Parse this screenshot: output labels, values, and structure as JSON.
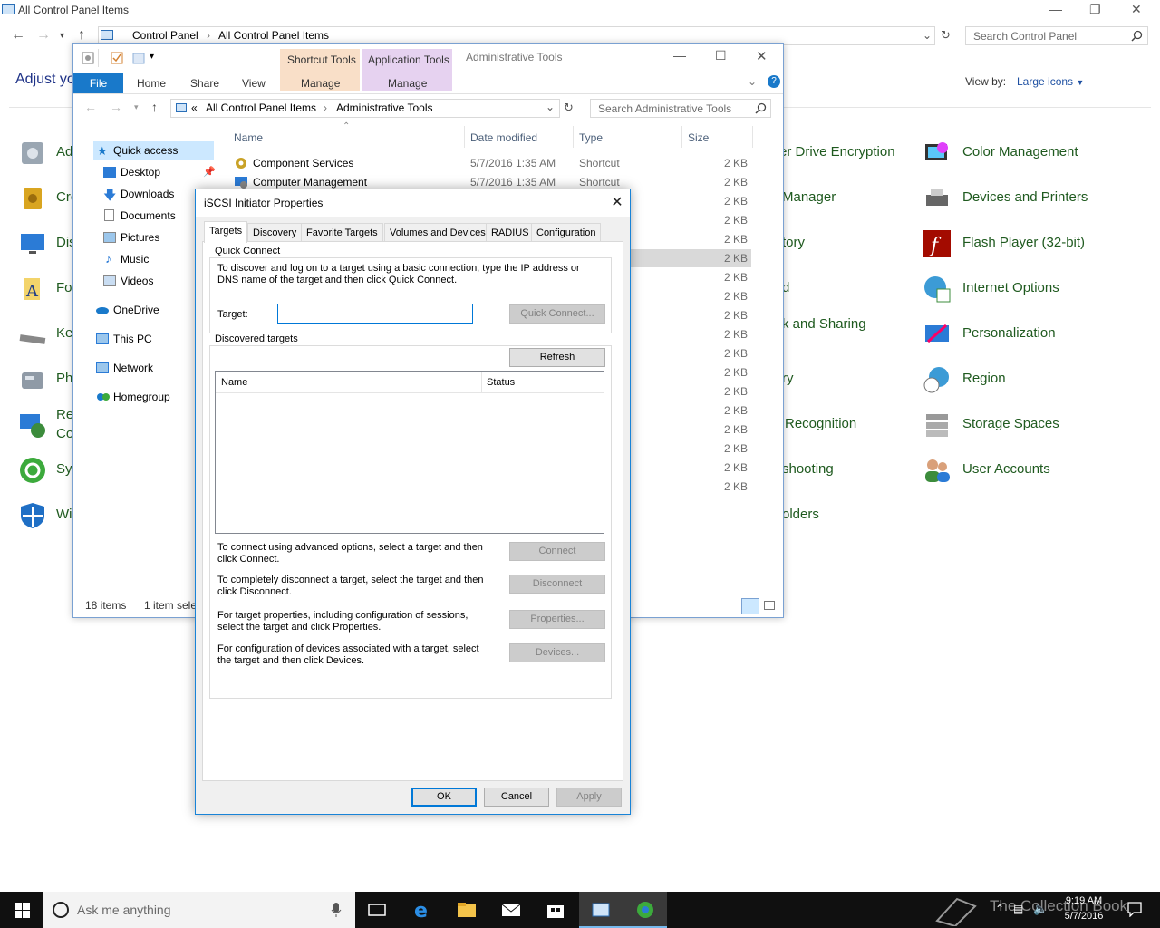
{
  "control_panel": {
    "title": "All Control Panel Items",
    "breadcrumb": [
      "Control Panel",
      "All Control Panel Items"
    ],
    "search_placeholder": "Search Control Panel",
    "heading": "Adjust yo",
    "view_by_label": "View by:",
    "view_by_value": "Large icons",
    "left_items": [
      {
        "label": "Ad",
        "icon": "admin-tools-icon"
      },
      {
        "label": "Cre",
        "icon": "credential-manager-icon"
      },
      {
        "label": "Dis",
        "icon": "display-icon"
      },
      {
        "label": "Fo",
        "icon": "fonts-icon"
      },
      {
        "label": "Ke",
        "icon": "keyboard-icon"
      },
      {
        "label": "Ph",
        "icon": "phone-modem-icon"
      },
      {
        "label": "Re",
        "label2": "Co",
        "icon": "remoteapp-icon"
      },
      {
        "label": "Sy",
        "icon": "sync-center-icon"
      },
      {
        "label": "Wi",
        "icon": "windows-defender-icon"
      }
    ],
    "mid_items": [
      "er Drive Encryption",
      "Manager",
      "tory",
      "d",
      "k and Sharing",
      "ry",
      "Recognition",
      "shooting",
      "olders"
    ],
    "right_items": [
      {
        "label": "Color Management",
        "icon": "color-management-icon",
        "color": "#8a2be2"
      },
      {
        "label": "Devices and Printers",
        "icon": "devices-printers-icon",
        "color": "#555555"
      },
      {
        "label": "Flash Player (32-bit)",
        "icon": "flash-player-icon",
        "color": "#b30b00"
      },
      {
        "label": "Internet Options",
        "icon": "internet-options-icon",
        "color": "#2b7bd6"
      },
      {
        "label": "Personalization",
        "icon": "personalization-icon",
        "color": "#2b7bd6"
      },
      {
        "label": "Region",
        "icon": "region-icon",
        "color": "#2b7bd6"
      },
      {
        "label": "Storage Spaces",
        "icon": "storage-spaces-icon",
        "color": "#777777"
      },
      {
        "label": "User Accounts",
        "icon": "user-accounts-icon",
        "color": "#3c8c3c"
      },
      {
        "label": "",
        "icon": "",
        "color": ""
      }
    ]
  },
  "explorer": {
    "context_tabs": {
      "shortcut": "Shortcut Tools",
      "application": "Application Tools",
      "window_title": "Administrative Tools"
    },
    "tabs": {
      "file": "File",
      "home": "Home",
      "share": "Share",
      "view": "View",
      "manage1": "Manage",
      "manage2": "Manage"
    },
    "address": [
      "All Control Panel Items",
      "Administrative Tools"
    ],
    "address_prefix": "«",
    "search_placeholder": "Search Administrative Tools",
    "nav": [
      {
        "label": "Quick access",
        "icon": "star-icon"
      },
      {
        "label": "Desktop",
        "icon": "desktop-icon"
      },
      {
        "label": "Downloads",
        "icon": "download-icon"
      },
      {
        "label": "Documents",
        "icon": "documents-icon"
      },
      {
        "label": "Pictures",
        "icon": "pictures-icon"
      },
      {
        "label": "Music",
        "icon": "music-icon"
      },
      {
        "label": "Videos",
        "icon": "videos-icon"
      },
      {
        "label": "OneDrive",
        "icon": "onedrive-icon"
      },
      {
        "label": "This PC",
        "icon": "this-pc-icon"
      },
      {
        "label": "Network",
        "icon": "network-icon"
      },
      {
        "label": "Homegroup",
        "icon": "homegroup-icon"
      }
    ],
    "columns": {
      "name": "Name",
      "date": "Date modified",
      "type": "Type",
      "size": "Size"
    },
    "rows": [
      {
        "name": "Component Services",
        "date": "5/7/2016 1:35 AM",
        "type": "Shortcut",
        "size": "2 KB"
      },
      {
        "name": "Computer Management",
        "date": "5/7/2016 1:35 AM",
        "type": "Shortcut",
        "size": "2 KB"
      }
    ],
    "sizes": [
      "2 KB",
      "2 KB",
      "2 KB",
      "2 KB",
      "2 KB",
      "2 KB",
      "2 KB",
      "2 KB",
      "2 KB",
      "2 KB",
      "2 KB",
      "2 KB",
      "2 KB",
      "2 KB",
      "2 KB",
      "2 KB",
      "2 KB",
      "2 KB"
    ],
    "status_items": "18 items",
    "status_selected": "1 item sele"
  },
  "dialog": {
    "title": "iSCSI Initiator Properties",
    "tabs": [
      "Targets",
      "Discovery",
      "Favorite Targets",
      "Volumes and Devices",
      "RADIUS",
      "Configuration"
    ],
    "quick_connect": {
      "legend": "Quick Connect",
      "description": "To discover and log on to a target using a basic connection, type the IP address or DNS name of the target and then click Quick Connect.",
      "target_label": "Target:",
      "target_value": "",
      "button": "Quick Connect..."
    },
    "discovered": {
      "legend": "Discovered targets",
      "refresh": "Refresh",
      "col_name": "Name",
      "col_status": "Status"
    },
    "actions": [
      {
        "text": "To connect using advanced options, select a target and then click Connect.",
        "button": "Connect"
      },
      {
        "text": "To completely disconnect a target, select the target and then click Disconnect.",
        "button": "Disconnect"
      },
      {
        "text": "For target properties, including configuration of sessions, select the target and click Properties.",
        "button": "Properties..."
      },
      {
        "text": "For configuration of devices associated with a target, select the target and then click Devices.",
        "button": "Devices..."
      }
    ],
    "ok": "OK",
    "cancel": "Cancel",
    "apply": "Apply"
  },
  "taskbar": {
    "search_placeholder": "Ask me anything",
    "time": "9:19 AM",
    "date": "5/7/2016",
    "watermark": "The Collection Book"
  }
}
